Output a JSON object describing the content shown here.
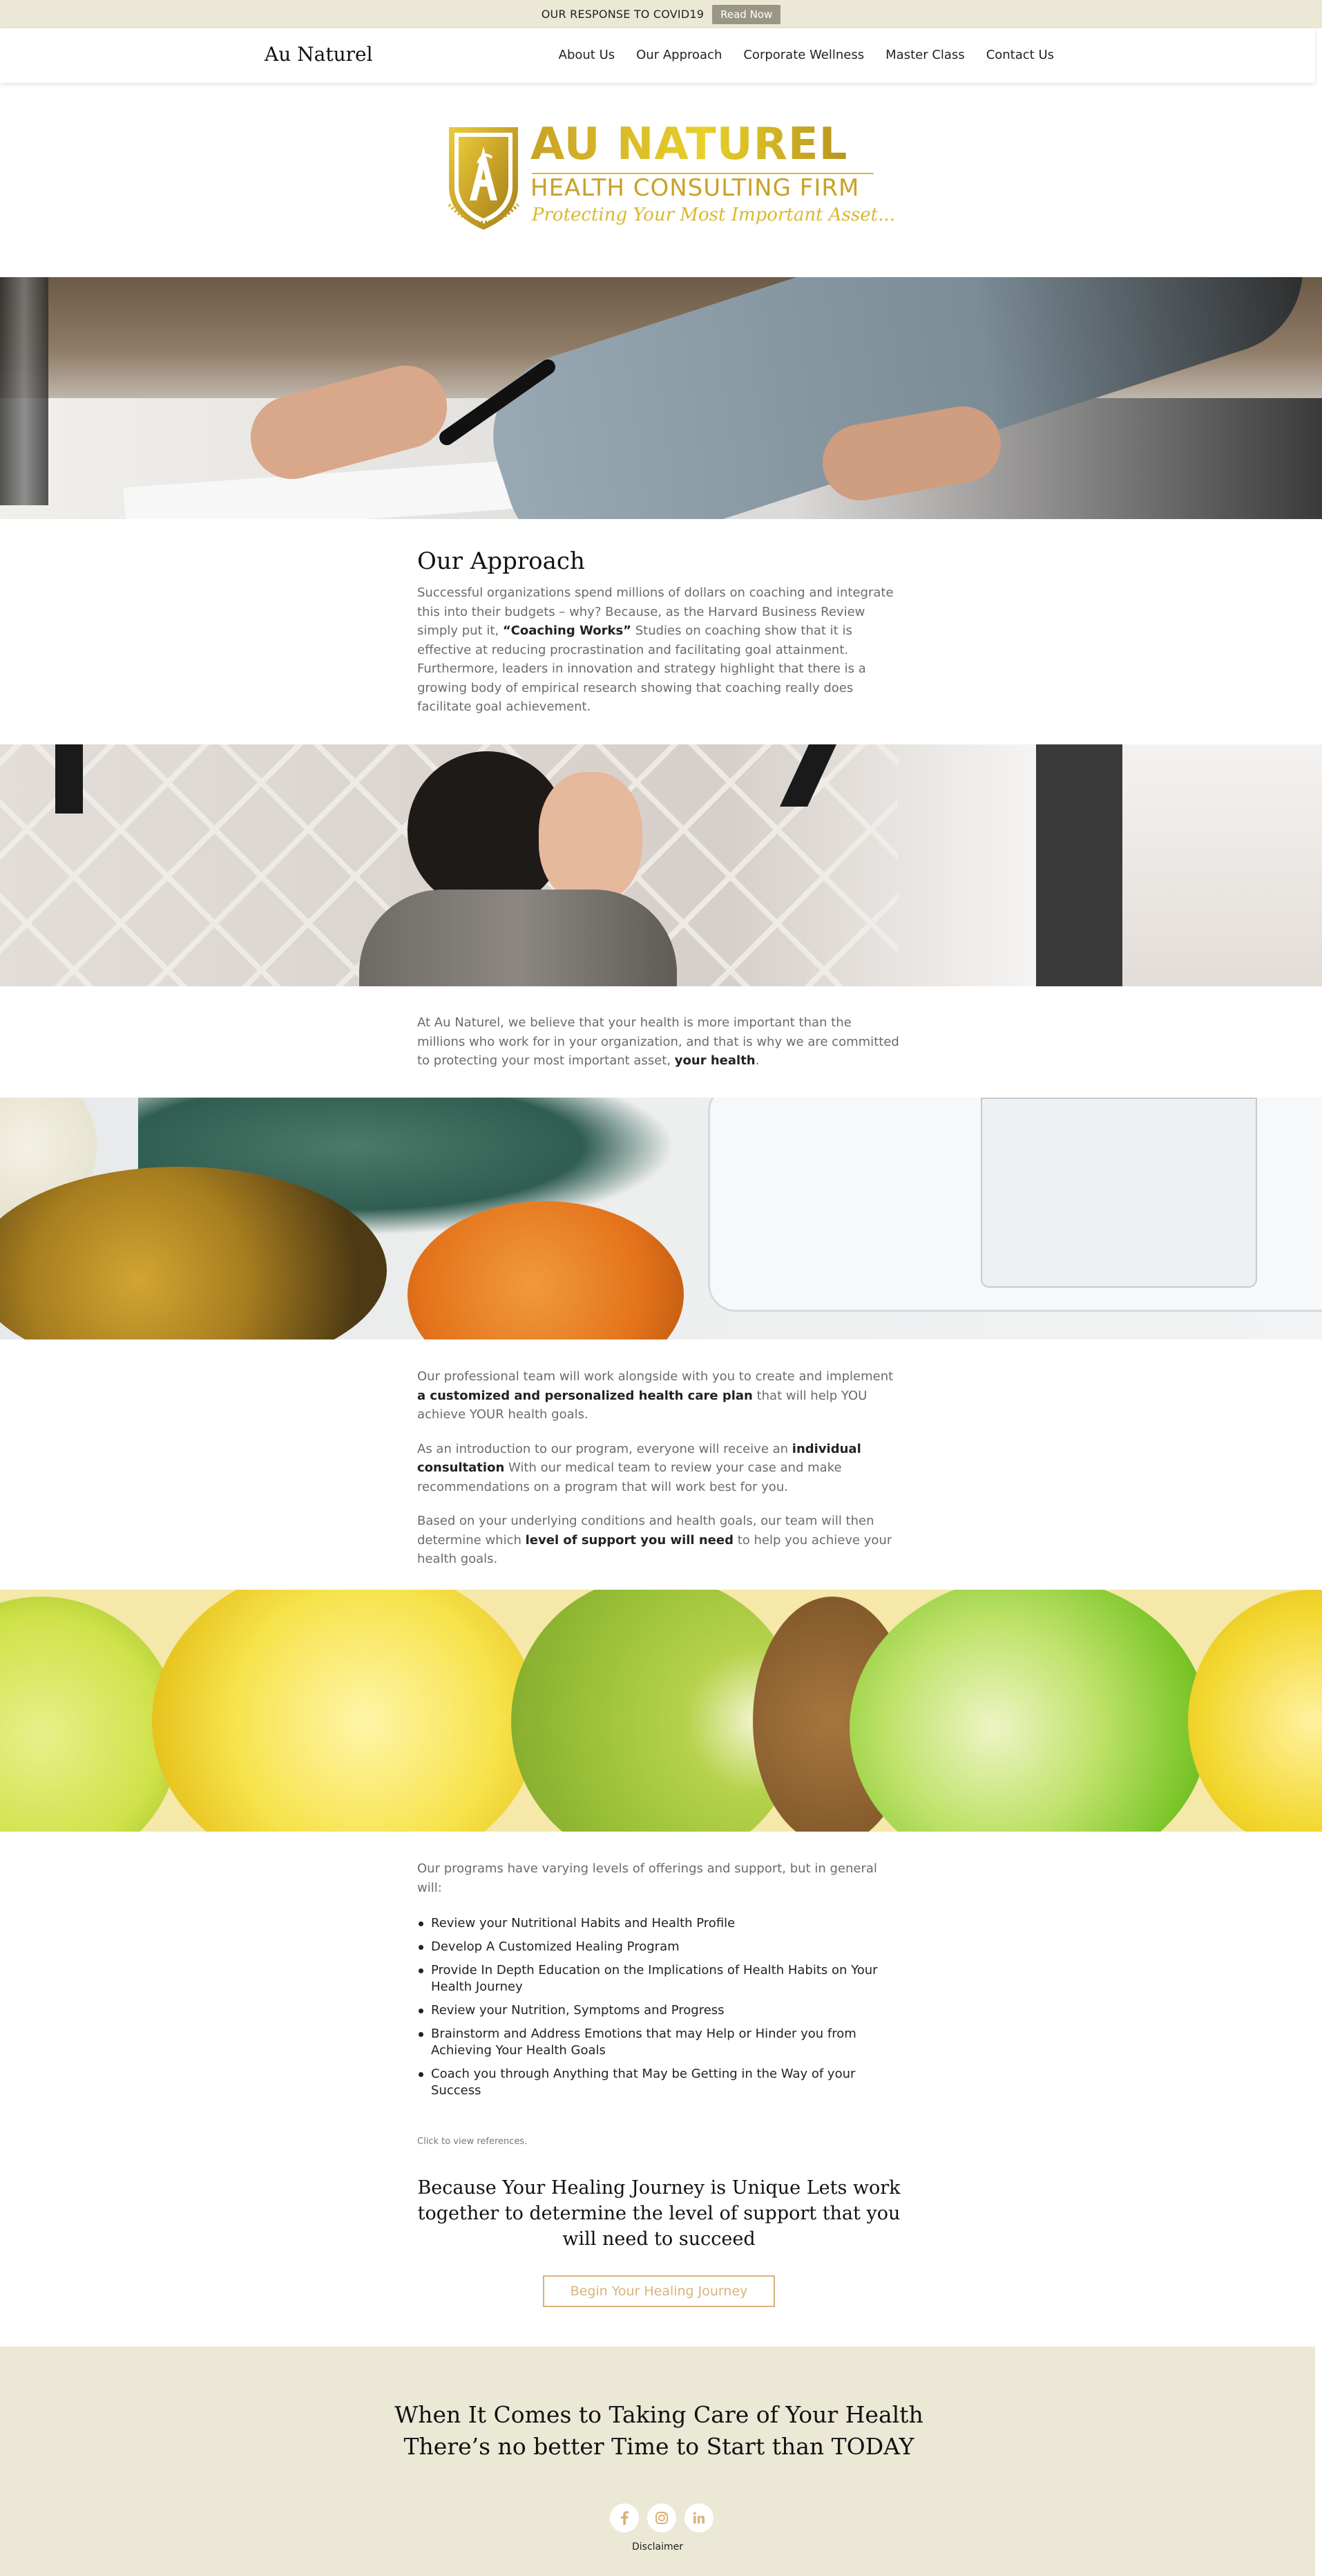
{
  "topbar": {
    "notice": "OUR RESPONSE TO COVID19",
    "read_now": "Read Now"
  },
  "header": {
    "brand": "Au Naturel",
    "nav": [
      "About Us",
      "Our Approach",
      "Corporate Wellness",
      "Master Class",
      "Contact Us"
    ]
  },
  "logo": {
    "title": "AU NATUREL",
    "subtitle": "HEALTH CONSULTING FIRM",
    "tagline": "Protecting Your Most Important Asset...",
    "monogram": "AN"
  },
  "approach": {
    "heading": "Our Approach",
    "text_before": "Successful organizations spend millions of dollars on coaching and integrate this into their budgets – why? Because, as the Harvard Business Review simply put it, ",
    "text_bold": "“Coaching Works”",
    "text_after": " Studies on coaching show that it is effective at reducing procrastination and facilitating goal attainment. Furthermore, leaders in innovation and strategy highlight that there is a growing body of empirical research showing that coaching really does facilitate goal achievement."
  },
  "belief": {
    "text_before": "At Au Naturel, we believe that your health is more important than the millions who work for in your organization, and that is why we are committed to protecting your most important asset, ",
    "text_bold": "your health",
    "text_after": "."
  },
  "team": {
    "p1_before": "Our professional team will work alongside with you to create and implement ",
    "p1_bold": "a customized and personalized health care plan",
    "p1_after": " that will help YOU achieve YOUR health goals.",
    "p2_before": "As an introduction to our program, everyone will receive an ",
    "p2_bold": "individual consultation",
    "p2_after": " With our medical team to review your case and make recommendations on a program that will work best for you.",
    "p3_before": "Based on your underlying conditions and health goals, our team will then determine which ",
    "p3_bold": "level of support you will need",
    "p3_after": " to help you achieve your health goals."
  },
  "programs": {
    "intro": "Our programs have varying levels of offerings and support, but in general will:",
    "items": [
      "Review your Nutritional Habits and Health Profile",
      "Develop A Customized Healing Program",
      "Provide In Depth Education on the Implications of Health Habits on Your Health Journey",
      "Review your Nutrition, Symptoms and Progress",
      "Brainstorm and Address Emotions that may Help or Hinder you from Achieving Your Health Goals",
      "Coach you through Anything that May be Getting in the Way of your Success"
    ],
    "references": "Click to view references."
  },
  "cta": {
    "heading": "Because Your Healing Journey is Unique Lets work together to determine the level of support that you will need to succeed",
    "button": "Begin Your Healing Journey"
  },
  "footer": {
    "heading_line1": "When It Comes to Taking Care of Your Health",
    "heading_line2": "There’s no better Time to Start than TODAY",
    "socials": [
      "facebook-icon",
      "instagram-icon",
      "linkedin-icon"
    ],
    "disclaimer": "Disclaimer"
  },
  "colors": {
    "topbar_bg": "#ebe8d6",
    "read_now_bg": "#9a9684",
    "gold": "#c9a227",
    "button_border": "#d9b37a",
    "footer_bg": "#ebe8d6"
  }
}
